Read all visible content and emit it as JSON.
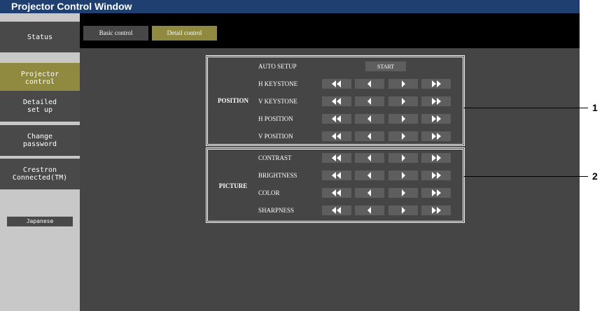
{
  "window": {
    "title": "Projector Control Window"
  },
  "sidebar": {
    "items": [
      {
        "label": "Status",
        "active": false
      },
      {
        "label": "Projector\ncontrol",
        "active": true
      },
      {
        "label": "Detailed\nset up",
        "active": false
      },
      {
        "label": "Change\npassword",
        "active": false
      },
      {
        "label": "Crestron\nConnected(TM)",
        "active": false
      }
    ],
    "language_button": "Japanese"
  },
  "tabs": [
    {
      "label": "Basic control",
      "active": false
    },
    {
      "label": "Detail control",
      "active": true
    }
  ],
  "position_group": {
    "label": "POSITION",
    "auto_setup": {
      "label": "AUTO SETUP",
      "button": "START"
    },
    "rows": [
      "H KEYSTONE",
      "V KEYSTONE",
      "H POSITION",
      "V POSITION"
    ]
  },
  "picture_group": {
    "label": "PICTURE",
    "rows": [
      "CONTRAST",
      "BRIGHTNESS",
      "COLOR",
      "SHARPNESS"
    ]
  },
  "arrow_buttons": [
    "fast-left-icon",
    "left-icon",
    "right-icon",
    "fast-right-icon"
  ],
  "callouts": [
    "1",
    "2"
  ],
  "colors": {
    "title_bar": "#1f3f70",
    "nav_button": "#494949",
    "active": "#8f8a3f",
    "content_bg": "#454545",
    "control_button": "#5e5e5e"
  }
}
